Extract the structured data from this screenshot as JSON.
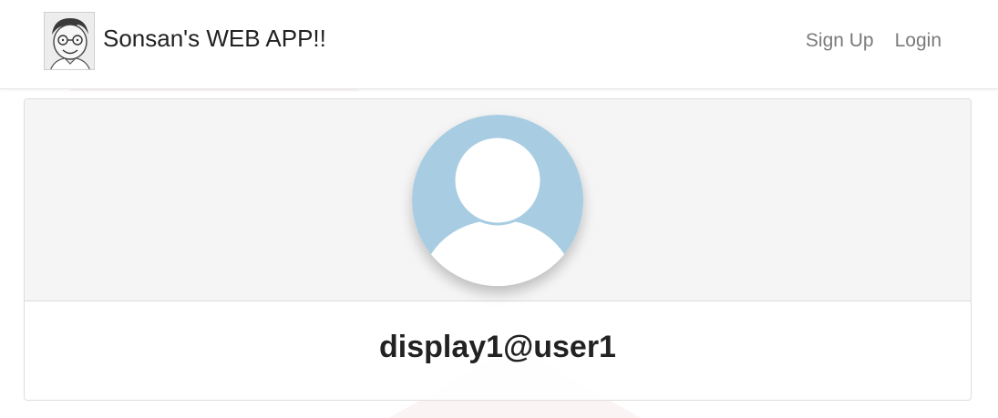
{
  "navbar": {
    "brand_title": "Sonsan's WEB APP!!",
    "links": [
      {
        "label": "Sign Up"
      },
      {
        "label": "Login"
      }
    ]
  },
  "profile": {
    "display_name": "display1@user1"
  },
  "colors": {
    "avatar_background": "#a8cde2",
    "card_header_background": "#f5f5f5",
    "nav_link": "#7a7a7a",
    "text": "#222222"
  },
  "icons": {
    "brand_logo": "cartoon-face-avatar",
    "profile_avatar": "default-user-icon"
  }
}
